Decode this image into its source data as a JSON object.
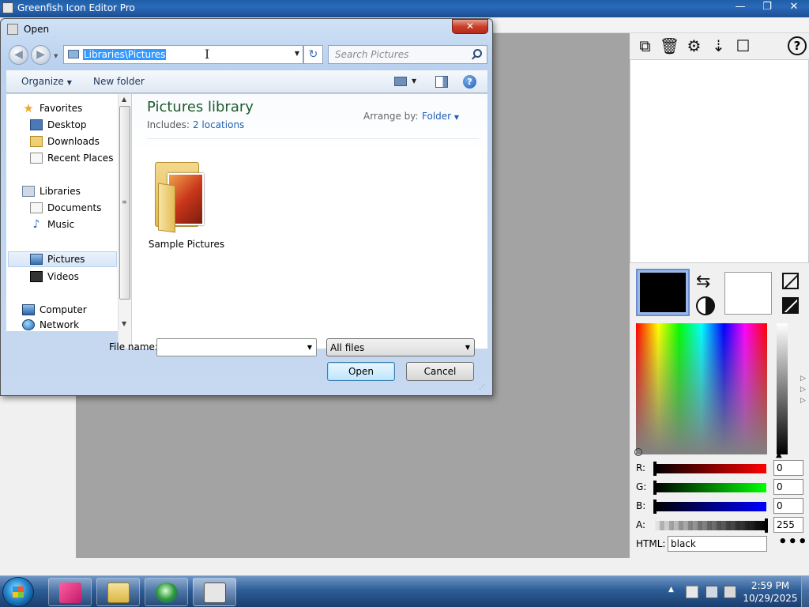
{
  "app": {
    "title": "Greenfish Icon Editor Pro",
    "window_buttons": [
      "—",
      "❐",
      "✕"
    ]
  },
  "right_panel": {
    "tools": [
      {
        "name": "new-layer-icon",
        "glyph": "⧉"
      },
      {
        "name": "delete-icon",
        "glyph": "🗑"
      },
      {
        "name": "settings-icon",
        "glyph": "⚙"
      },
      {
        "name": "merge-down-icon",
        "glyph": "⇣"
      },
      {
        "name": "crop-icon",
        "glyph": "☐"
      }
    ],
    "help_glyph": "?",
    "swap_glyph": "⇆",
    "primary_color": "#000000",
    "secondary_color": "#ffffff",
    "channels": {
      "r": {
        "label": "R:",
        "value": "0"
      },
      "g": {
        "label": "G:",
        "value": "0"
      },
      "b": {
        "label": "B:",
        "value": "0"
      },
      "a": {
        "label": "A:",
        "value": "255"
      }
    },
    "html_label": "HTML:",
    "html_value": "black",
    "more_glyph": "•••"
  },
  "dialog": {
    "title": "Open",
    "close_glyph": "✕",
    "back_glyph": "◀",
    "forward_glyph": "▶",
    "address": "Libraries\\Pictures",
    "search_placeholder": "Search Pictures",
    "refresh_glyph": "↻",
    "organize_label": "Organize",
    "new_folder_label": "New folder",
    "help_glyph": "?",
    "nav": {
      "favorites": "Favorites",
      "desktop": "Desktop",
      "downloads": "Downloads",
      "recent_places": "Recent Places",
      "libraries": "Libraries",
      "documents": "Documents",
      "music": "Music",
      "pictures": "Pictures",
      "videos": "Videos",
      "computer": "Computer",
      "network": "Network"
    },
    "library_title": "Pictures library",
    "includes_label": "Includes:",
    "includes_link": "2 locations",
    "arrange_by_label": "Arrange by:",
    "arrange_by_value": "Folder",
    "items": [
      {
        "label": "Sample Pictures"
      }
    ],
    "file_name_label": "File name:",
    "file_name_value": "",
    "file_type": "All files",
    "open_label": "Open",
    "cancel_label": "Cancel"
  },
  "taskbar": {
    "time": "2:59 PM",
    "date": "10/29/2025"
  }
}
